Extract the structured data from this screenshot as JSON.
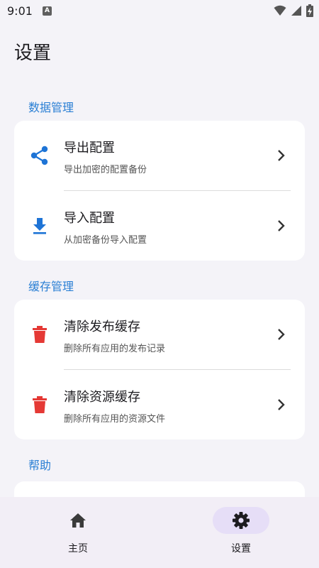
{
  "status_bar": {
    "time": "9:01",
    "notification_letter": "A"
  },
  "page_title": "设置",
  "sections": [
    {
      "label": "数据管理",
      "items": [
        {
          "title": "导出配置",
          "subtitle": "导出加密的配置备份",
          "icon": "share-icon",
          "icon_color": "#1e74d6"
        },
        {
          "title": "导入配置",
          "subtitle": "从加密备份导入配置",
          "icon": "download-icon",
          "icon_color": "#1e74d6"
        }
      ]
    },
    {
      "label": "缓存管理",
      "items": [
        {
          "title": "清除发布缓存",
          "subtitle": "删除所有应用的发布记录",
          "icon": "trash-icon",
          "icon_color": "#e53935"
        },
        {
          "title": "清除资源缓存",
          "subtitle": "删除所有应用的资源文件",
          "icon": "trash-icon",
          "icon_color": "#e53935"
        }
      ]
    },
    {
      "label": "帮助",
      "items": []
    }
  ],
  "bottom_nav": {
    "items": [
      {
        "label": "主页",
        "icon": "home-icon",
        "active": false
      },
      {
        "label": "设置",
        "icon": "gear-icon",
        "active": true
      }
    ]
  },
  "colors": {
    "accent": "#2a7fd4",
    "background": "#f4f3f8",
    "nav_background": "#f2eef6",
    "nav_active_pill": "#e6def7",
    "danger": "#e53935"
  }
}
